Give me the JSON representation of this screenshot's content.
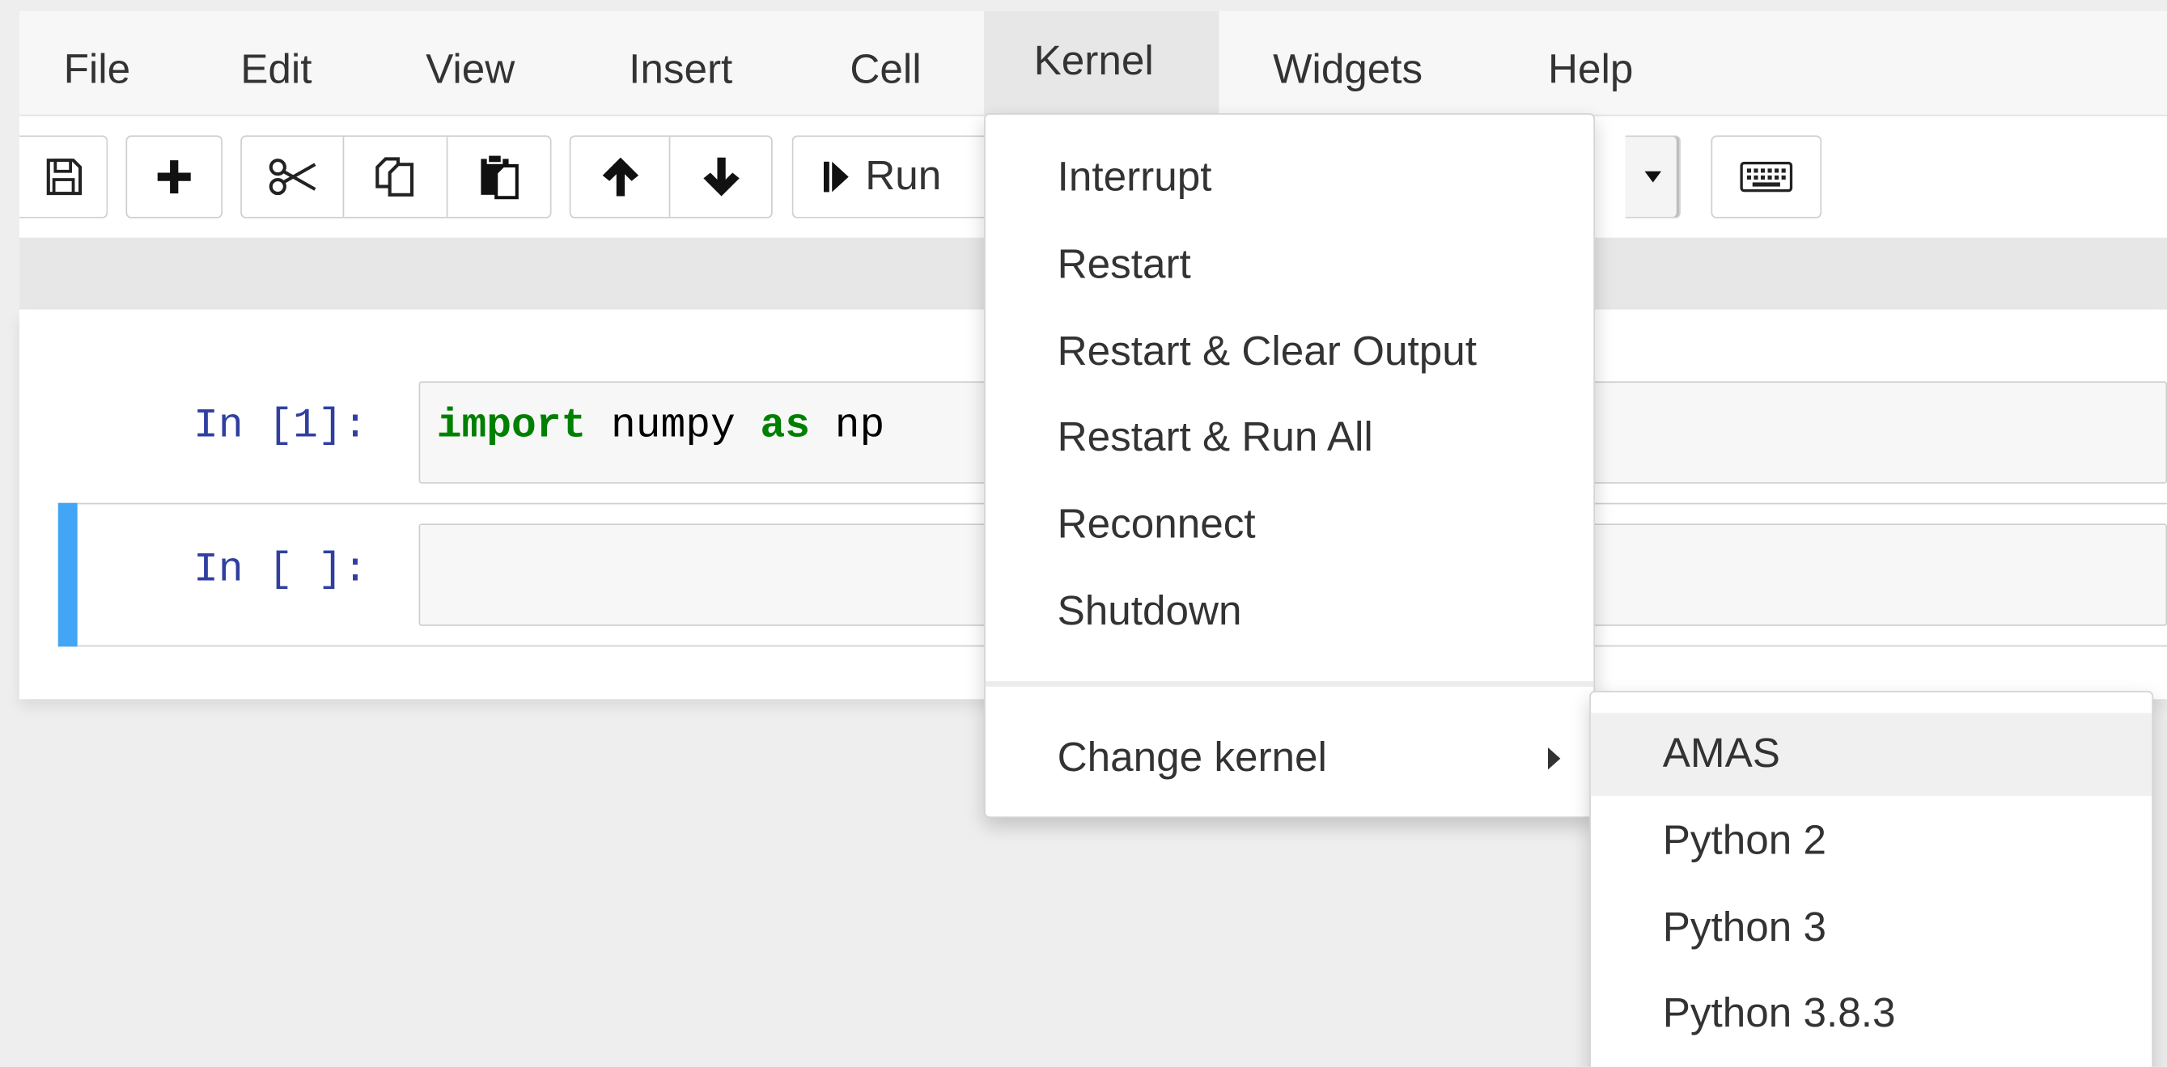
{
  "menubar": {
    "items": [
      {
        "label": "File"
      },
      {
        "label": "Edit"
      },
      {
        "label": "View"
      },
      {
        "label": "Insert"
      },
      {
        "label": "Cell"
      },
      {
        "label": "Kernel",
        "active": true
      },
      {
        "label": "Widgets"
      },
      {
        "label": "Help"
      }
    ]
  },
  "toolbar": {
    "buttons": [
      {
        "name": "save",
        "icon": "save-icon"
      },
      {
        "name": "insert-cell-below",
        "icon": "plus-icon"
      },
      {
        "name": "cut",
        "icon": "scissors-icon"
      },
      {
        "name": "copy",
        "icon": "copy-icon"
      },
      {
        "name": "paste",
        "icon": "paste-icon"
      },
      {
        "name": "move-up",
        "icon": "arrow-up-icon"
      },
      {
        "name": "move-down",
        "icon": "arrow-down-icon"
      },
      {
        "name": "run",
        "icon": "step-forward-icon"
      },
      {
        "name": "cell-type-dropdown",
        "icon": "caret-down-icon"
      },
      {
        "name": "keyboard-shortcuts",
        "icon": "keyboard-icon"
      }
    ],
    "run_label": "Run"
  },
  "cells": [
    {
      "prompt": "In [1]:",
      "code_tokens": [
        {
          "text": "import",
          "type": "keyword"
        },
        {
          "text": " numpy ",
          "type": "plain"
        },
        {
          "text": "as",
          "type": "keyword"
        },
        {
          "text": " np",
          "type": "plain"
        }
      ]
    },
    {
      "prompt": "In [ ]:",
      "selected": true,
      "code": ""
    }
  ],
  "kernel_menu": {
    "items": [
      {
        "label": "Interrupt"
      },
      {
        "label": "Restart"
      },
      {
        "label": "Restart & Clear Output"
      },
      {
        "label": "Restart & Run All"
      },
      {
        "label": "Reconnect"
      },
      {
        "label": "Shutdown"
      }
    ],
    "change_kernel_label": "Change kernel",
    "kernels": [
      {
        "label": "AMAS",
        "highlighted": true
      },
      {
        "label": "Python 2"
      },
      {
        "label": "Python 3"
      },
      {
        "label": "Python 3.8.3"
      }
    ]
  },
  "colors": {
    "selection_bar": "#42a5f5",
    "prompt": "#303f9f",
    "keyword": "#008000"
  }
}
